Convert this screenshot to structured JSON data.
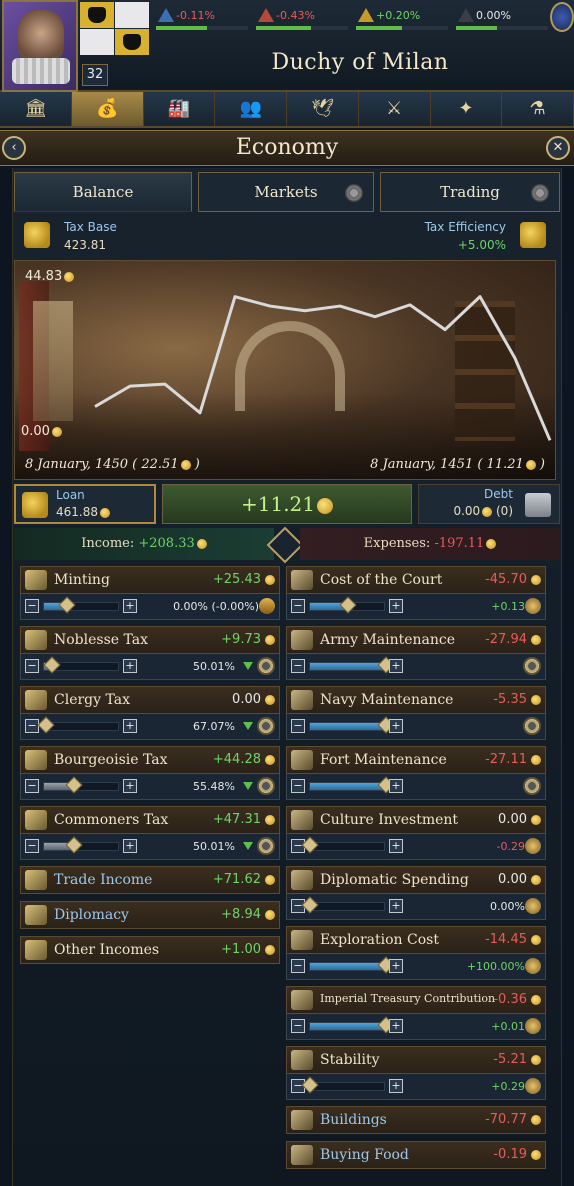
{
  "country_name": "Duchy of Milan",
  "ruler_rank": "32",
  "top_stats": [
    {
      "value": "-0.11%",
      "tone": "neg",
      "icon": "estate-icon-blue",
      "fill": 0.55
    },
    {
      "value": "-0.43%",
      "tone": "neg",
      "icon": "estate-icon-red",
      "fill": 0.6
    },
    {
      "value": "+0.20%",
      "tone": "pos",
      "icon": "estate-icon-gold",
      "fill": 0.5
    },
    {
      "value": "0.00%",
      "tone": "neu",
      "icon": "estate-icon-dark",
      "fill": 0.45
    }
  ],
  "nav_tabs": [
    {
      "name": "government-tab",
      "icon": "building-icon",
      "glyph": "🏛"
    },
    {
      "name": "economy-tab",
      "icon": "money-bag-icon",
      "glyph": "💰",
      "active": true
    },
    {
      "name": "production-tab",
      "icon": "factory-icon",
      "glyph": "🏭"
    },
    {
      "name": "population-tab",
      "icon": "people-icon",
      "glyph": "👥"
    },
    {
      "name": "diplomacy-tab",
      "icon": "dove-icon",
      "glyph": "🕊"
    },
    {
      "name": "military-tab",
      "icon": "crossed-swords-icon",
      "glyph": "⚔"
    },
    {
      "name": "exploration-tab",
      "icon": "compass-icon",
      "glyph": "✦"
    },
    {
      "name": "science-tab",
      "icon": "flask-icon",
      "glyph": "⚗"
    }
  ],
  "header": {
    "title": "Economy",
    "back": "‹",
    "close": "✕"
  },
  "subtabs": {
    "balance": "Balance",
    "markets": "Markets",
    "trading": "Trading"
  },
  "tax_base": {
    "label": "Tax Base",
    "value": "423.81"
  },
  "tax_efficiency": {
    "label": "Tax Efficiency",
    "value": "+5.00%"
  },
  "chart_data": {
    "type": "line",
    "y_max_label": "44.83",
    "y_min_label": "0.00",
    "ylim": [
      0,
      44.83
    ],
    "start_label": "8 January, 1450 ( 22.51",
    "end_label": "8 January, 1451 ( 11.21",
    "series": [
      {
        "values": [
          10.3,
          15.5,
          16.0,
          8.7,
          38.3,
          35.9,
          34.7,
          35.9,
          33.2,
          36.2,
          29.9,
          38.3,
          22.6,
          1.7
        ]
      }
    ],
    "color": "#d9d9d9"
  },
  "loan": {
    "label": "Loan",
    "value": "461.88"
  },
  "balance": "+11.21",
  "debt": {
    "label": "Debt",
    "value": "0.00",
    "count": "(0)"
  },
  "income_label": "Income:",
  "income_total": "+208.33",
  "expenses_label": "Expenses:",
  "expenses_total": "-197.11",
  "income_items": [
    {
      "name": "Minting",
      "value": "+25.43",
      "tone": "pos",
      "has_slider": true,
      "pct": "0.00% (-0.00%)",
      "slider": 0.3,
      "fill_style": "blue"
    },
    {
      "name": "Noblesse Tax",
      "value": "+9.73",
      "tone": "pos",
      "has_slider": true,
      "pct": "50.01%",
      "slider": 0.1,
      "fill_style": "gray"
    },
    {
      "name": "Clergy Tax",
      "value": "0.00",
      "tone": "neu",
      "has_slider": true,
      "pct": "67.07%",
      "slider": 0.02,
      "fill_style": "gray"
    },
    {
      "name": "Bourgeoisie Tax",
      "value": "+44.28",
      "tone": "pos",
      "has_slider": true,
      "pct": "55.48%",
      "slider": 0.4,
      "fill_style": "gray"
    },
    {
      "name": "Commoners Tax",
      "value": "+47.31",
      "tone": "pos",
      "has_slider": true,
      "pct": "50.01%",
      "slider": 0.4,
      "fill_style": "gray"
    },
    {
      "name": "Trade Income",
      "value": "+71.62",
      "tone": "pos",
      "has_slider": false,
      "blue": true
    },
    {
      "name": "Diplomacy",
      "value": "+8.94",
      "tone": "pos",
      "has_slider": false,
      "blue": true
    },
    {
      "name": "Other Incomes",
      "value": "+1.00",
      "tone": "pos",
      "has_slider": false
    }
  ],
  "expense_items": [
    {
      "name": "Cost of the Court",
      "value": "-45.70",
      "tone": "neg",
      "has_slider": true,
      "pct": "+0.13",
      "slider": 0.5,
      "fill_style": "blue"
    },
    {
      "name": "Army Maintenance",
      "value": "-27.94",
      "tone": "neg",
      "has_slider": true,
      "pct": "",
      "slider": 1.0,
      "fill_style": "blue"
    },
    {
      "name": "Navy Maintenance",
      "value": "-5.35",
      "tone": "neg",
      "has_slider": true,
      "pct": "",
      "slider": 1.0,
      "fill_style": "blue"
    },
    {
      "name": "Fort Maintenance",
      "value": "-27.11",
      "tone": "neg",
      "has_slider": true,
      "pct": "",
      "slider": 1.0,
      "fill_style": "blue"
    },
    {
      "name": "Culture Investment",
      "value": "0.00",
      "tone": "neu",
      "has_slider": true,
      "pct": "-0.29",
      "slider": 0.0,
      "fill_style": "blue",
      "pct_tone": "neg"
    },
    {
      "name": "Diplomatic Spending",
      "value": "0.00",
      "tone": "neu",
      "has_slider": true,
      "pct": "0.00%",
      "slider": 0.0,
      "fill_style": "blue",
      "pct_tone": "neu"
    },
    {
      "name": "Exploration Cost",
      "value": "-14.45",
      "tone": "neg",
      "has_slider": true,
      "pct": "+100.00%",
      "slider": 1.0,
      "fill_style": "blue"
    },
    {
      "name": "Imperial Treasury Contribution",
      "value": "-0.36",
      "tone": "neg",
      "has_slider": true,
      "pct": "+0.01",
      "slider": 1.0,
      "fill_style": "blue",
      "small": true
    },
    {
      "name": "Stability",
      "value": "-5.21",
      "tone": "neg",
      "has_slider": true,
      "pct": "+0.29",
      "slider": 0.0,
      "fill_style": "blue"
    },
    {
      "name": "Buildings",
      "value": "-70.77",
      "tone": "neg",
      "has_slider": false,
      "blue": true
    },
    {
      "name": "Buying Food",
      "value": "-0.19",
      "tone": "neg",
      "has_slider": false,
      "blue": true
    }
  ]
}
